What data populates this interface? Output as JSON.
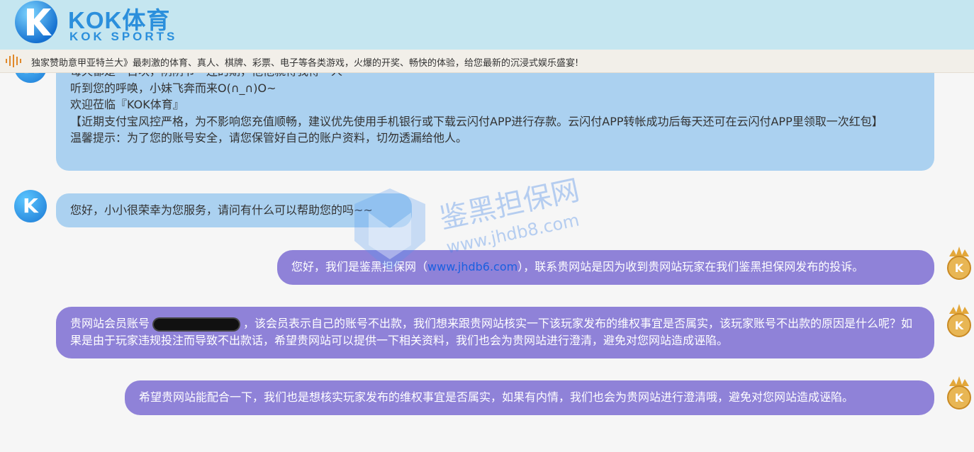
{
  "header": {
    "brand_title": "KOK体育",
    "brand_subtitle": "KOK SPORTS",
    "brand_color": "#2b8fdc",
    "background": "#c5e6f0"
  },
  "marquee": {
    "icon": "sound-wave-icon",
    "text": "独家赞助意甲亚特兰大》最刺激的体育、真人、棋牌、彩票、电子等各类游戏，火爆的开奖、畅快的体验，给您最新的沉浸式娱乐盛宴!"
  },
  "chat": {
    "messages": [
      {
        "side": "left",
        "lines": [
          "每天都是一百块，阴阴节一连的期，他他就得我得一人",
          "听到您的呼唤，小妹飞奔而来O(∩_∩)O~",
          "欢迎莅临『KOK体育』",
          "【近期支付宝风控严格，为不影响您充值顺畅，建议优先使用手机银行或下载云闪付APP进行存款。云闪付APP转帐成功后每天还可在云闪付APP里领取一次红包】",
          "温馨提示：为了您的账号安全，请您保管好自己的账户资料，切勿透漏给他人。"
        ]
      },
      {
        "side": "left",
        "text": "您好，小小很荣幸为您服务，请问有什么可以帮助您的吗~~"
      },
      {
        "side": "right",
        "text_before": "您好，我们是鉴黑担保网（",
        "link": "www.jhdb6.com",
        "text_after": "），联系贵网站是因为收到贵网站玩家在我们鉴黑担保网发布的投诉。"
      },
      {
        "side": "right",
        "text_before": "贵网站会员账号",
        "text_after": "，该会员表示自己的账号不出款，我们想来跟贵网站核实一下该玩家发布的维权事宜是否属实，该玩家账号不出款的原因是什么呢？如果是由于玩家违规投注而导致不出款话，希望贵网站可以提供一下相关资料，我们也会为贵网站进行澄清，避免对您网站造成诬陷。"
      },
      {
        "side": "right",
        "text": "希望贵网站能配合一下，我们也是想核实玩家发布的维权事宜是否属实，如果有内情，我们也会为贵网站进行澄清哦，避免对您网站造成诬陷。"
      }
    ],
    "colors": {
      "left_bubble": "#abd1f0",
      "right_bubble": "#8f82d8",
      "link": "#1a5fe0"
    },
    "icons": {
      "agent_avatar": "kok-k-logo-icon",
      "user_avatar": "gold-crown-avatar-icon"
    }
  },
  "watermark": {
    "cn": "鉴黑担保网",
    "en": "www.jhdb8.com"
  }
}
